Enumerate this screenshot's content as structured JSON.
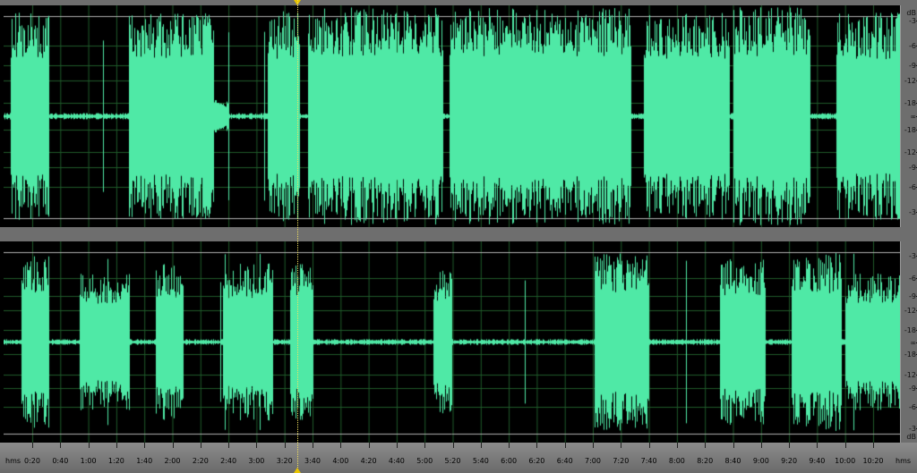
{
  "app": {
    "view": "waveform-editor"
  },
  "colors": {
    "waveform": "#4fe9a6",
    "background": "#000000",
    "grid": "#1f5a2a",
    "ruler": "#7a7a7a",
    "cursor": "#f0e060"
  },
  "db_scale": {
    "unit": "dB",
    "top": [
      "-3",
      "-6",
      "-9",
      "-12",
      "-18",
      "∞",
      "-18",
      "-12",
      "-9",
      "-6",
      "-3"
    ],
    "bottom": [
      "-3",
      "-6",
      "-9",
      "-12",
      "-18",
      "∞",
      "-18",
      "-12",
      "-9",
      "-6",
      "-3"
    ]
  },
  "time_ruler": {
    "unit_left": "hms",
    "unit_right": "hms",
    "labels": [
      "0:20",
      "0:40",
      "1:00",
      "1:20",
      "1:40",
      "2:00",
      "2:20",
      "2:40",
      "3:00",
      "3:20",
      "3:40",
      "4:00",
      "4:20",
      "4:40",
      "5:00",
      "5:20",
      "5:40",
      "6:00",
      "6:20",
      "6:40",
      "7:00",
      "7:20",
      "7:40",
      "8:00",
      "8:20",
      "8:40",
      "9:00",
      "9:20",
      "9:40",
      "10:00",
      "10:20"
    ]
  },
  "playhead": {
    "time": "3:36"
  },
  "tracks": {
    "top": {
      "segments": [
        [
          8,
          50,
          0.95
        ],
        [
          140,
          235,
          0.95
        ],
        [
          235,
          250,
          0.15
        ],
        [
          295,
          330,
          0.95
        ],
        [
          340,
          490,
          1.0
        ],
        [
          498,
          700,
          1.0
        ],
        [
          715,
          810,
          0.95
        ],
        [
          815,
          900,
          1.0
        ],
        [
          930,
          1000,
          0.95
        ]
      ]
    },
    "bottom": {
      "segments": [
        [
          20,
          50,
          0.9
        ],
        [
          85,
          140,
          0.7
        ],
        [
          170,
          200,
          0.8
        ],
        [
          245,
          300,
          0.8
        ],
        [
          320,
          345,
          0.85
        ],
        [
          480,
          500,
          0.75
        ],
        [
          660,
          720,
          0.9
        ],
        [
          800,
          850,
          0.85
        ],
        [
          880,
          935,
          0.9
        ],
        [
          940,
          1000,
          0.7
        ]
      ]
    }
  }
}
